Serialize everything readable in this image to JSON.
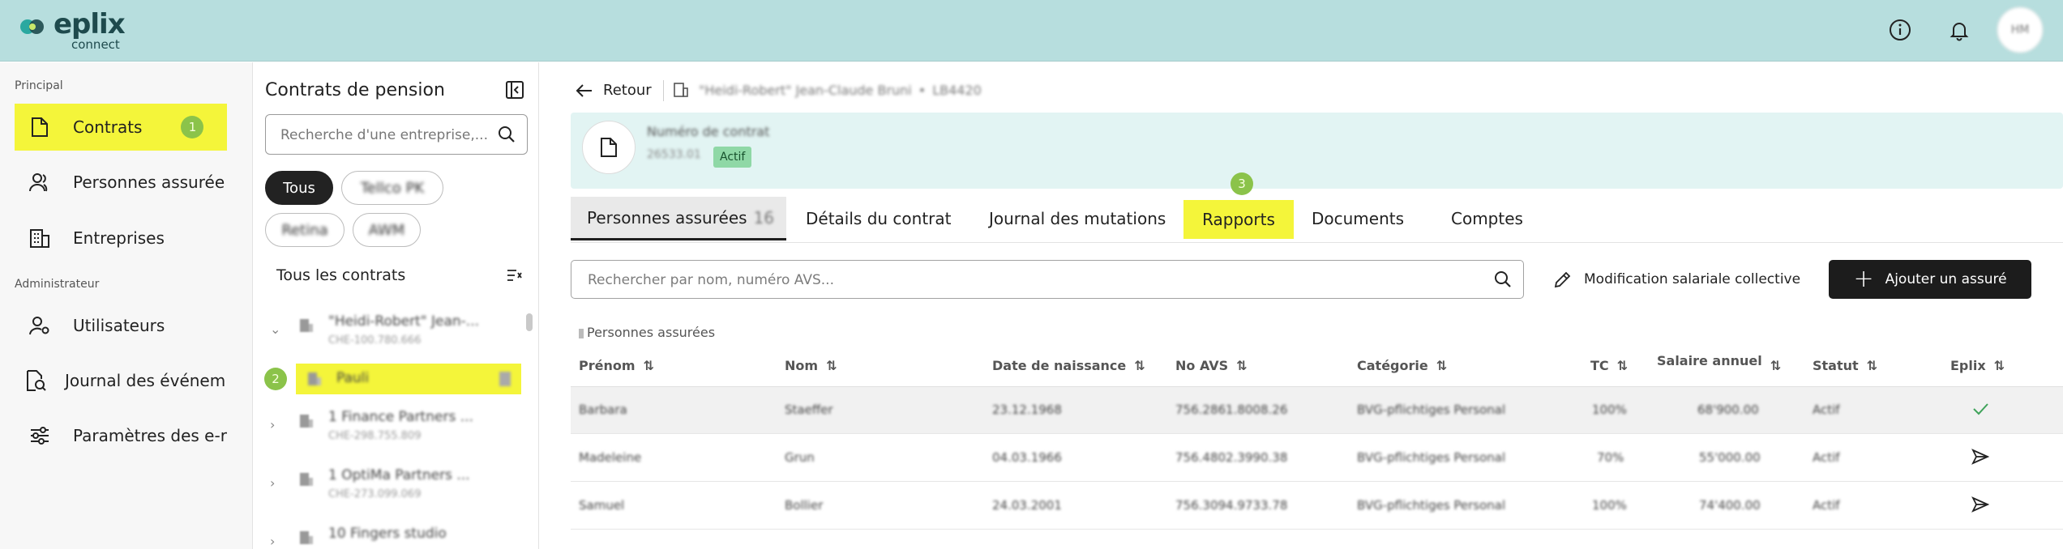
{
  "app": {
    "logo_text": "eplix",
    "logo_sub": "connect",
    "colors": {
      "header_bg": "#b7dede",
      "highlight": "#f4f53a",
      "badge": "#8bc34a",
      "primary_button": "#1c1c1c",
      "status_active": "#8fd8a6"
    }
  },
  "topbar": {
    "icons": [
      "info-icon",
      "bell-icon"
    ],
    "avatar_initials": "HM"
  },
  "sidebar": {
    "section_principal": "Principal",
    "section_admin": "Administrateur",
    "items": [
      {
        "label": "Contrats",
        "icon": "document-icon",
        "badge": "1"
      },
      {
        "label": "Personnes assurée",
        "icon": "people-icon"
      },
      {
        "label": "Entreprises",
        "icon": "building-icon"
      },
      {
        "label": "Utilisateurs",
        "icon": "user-gear-icon"
      },
      {
        "label": "Journal des événem",
        "icon": "search-document-icon"
      },
      {
        "label": "Paramètres des e-r",
        "icon": "sliders-icon"
      }
    ]
  },
  "contracts_panel": {
    "title": "Contrats de pension",
    "search_placeholder": "Recherche d'une entreprise,...",
    "chips": [
      "Tous",
      "Tellco PK",
      "Retina",
      "AWM"
    ],
    "subtitle": "Tous les contrats",
    "badge": "2",
    "tree": [
      {
        "line1": "\"Heidi-Robert\" Jean-...",
        "line2": "CHE-100.780.666"
      },
      {
        "line1": "Pauli"
      },
      {
        "line1": "1 Finance Partners ...",
        "line2": "CHE-298.755.809"
      },
      {
        "line1": "1 OptiMa Partners ...",
        "line2": "CHE-273.099.069"
      },
      {
        "line1": "10 Fingers studio"
      }
    ]
  },
  "main": {
    "back_label": "Retour",
    "breadcrumb_company": "\"Heidi-Robert\" Jean-Claude Bruni",
    "breadcrumb_contract": "LB4420",
    "contract_label": "Numéro de contrat",
    "contract_number": "26533.01",
    "status": "Actif",
    "badge": "3",
    "tabs": [
      {
        "label": "Personnes assurées",
        "count": "16"
      },
      {
        "label": "Détails du contrat"
      },
      {
        "label": "Journal des mutations"
      },
      {
        "label": "Rapports"
      },
      {
        "label": "Documents"
      },
      {
        "label": "Comptes"
      }
    ],
    "search_placeholder": "Rechercher par nom, numéro AVS...",
    "modify_label": "Modification salariale collective",
    "add_label": "Ajouter un assuré",
    "section_label": "Personnes assurées",
    "columns": [
      "Prénom",
      "Nom",
      "Date de naissance",
      "No AVS",
      "Catégorie",
      "TC",
      "Salaire annuel",
      "Statut",
      "Eplix"
    ],
    "rows": [
      {
        "prenom": "Barbara",
        "nom": "Staeffer",
        "dob": "23.12.1968",
        "avs": "756.2861.8008.26",
        "cat": "BVG-pflichtiges Personal",
        "tc": "100%",
        "salary": "68'900.00",
        "statut": "Actif",
        "eplix": "check-icon"
      },
      {
        "prenom": "Madeleine",
        "nom": "Grun",
        "dob": "04.03.1966",
        "avs": "756.4802.3990.38",
        "cat": "BVG-pflichtiges Personal",
        "tc": "70%",
        "salary": "55'000.00",
        "statut": "Actif",
        "eplix": "send-icon"
      },
      {
        "prenom": "Samuel",
        "nom": "Bollier",
        "dob": "24.03.2001",
        "avs": "756.3094.9733.78",
        "cat": "BVG-pflichtiges Personal",
        "tc": "100%",
        "salary": "74'400.00",
        "statut": "Actif",
        "eplix": "send-icon"
      }
    ]
  }
}
